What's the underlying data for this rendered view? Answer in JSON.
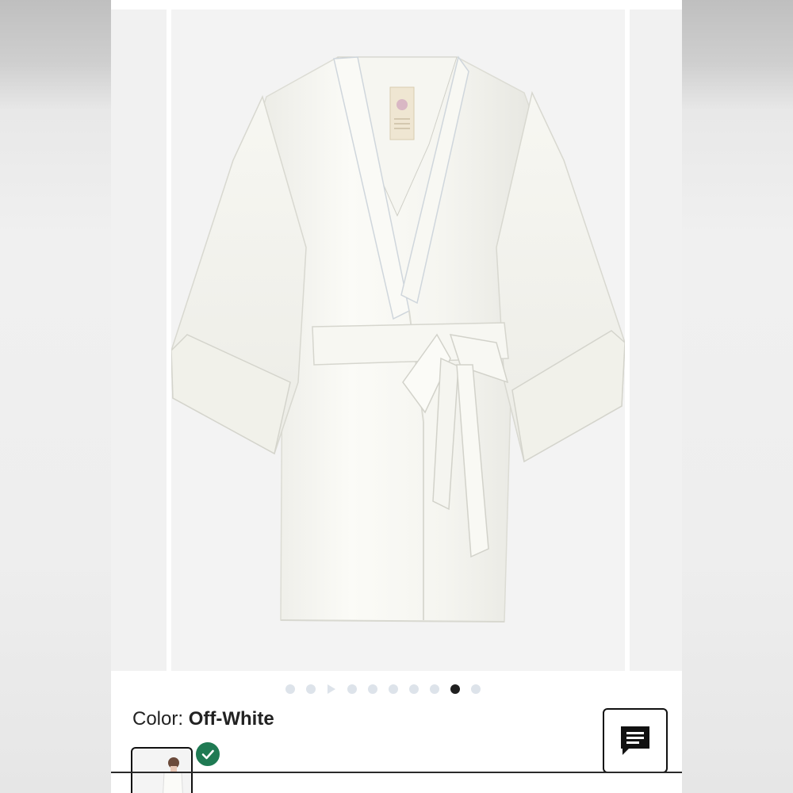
{
  "product": {
    "color_label": "Color:",
    "color_value": "Off-White"
  },
  "carousel": {
    "total_slides": 10,
    "active_index": 8,
    "video_slide_index": 2
  },
  "icons": {
    "selected": "check-icon",
    "chat": "chat-icon",
    "video": "play-icon"
  },
  "colors": {
    "accent_green": "#1f7a53",
    "dot_inactive": "#dde3ea",
    "dot_active": "#1f1f1f"
  }
}
